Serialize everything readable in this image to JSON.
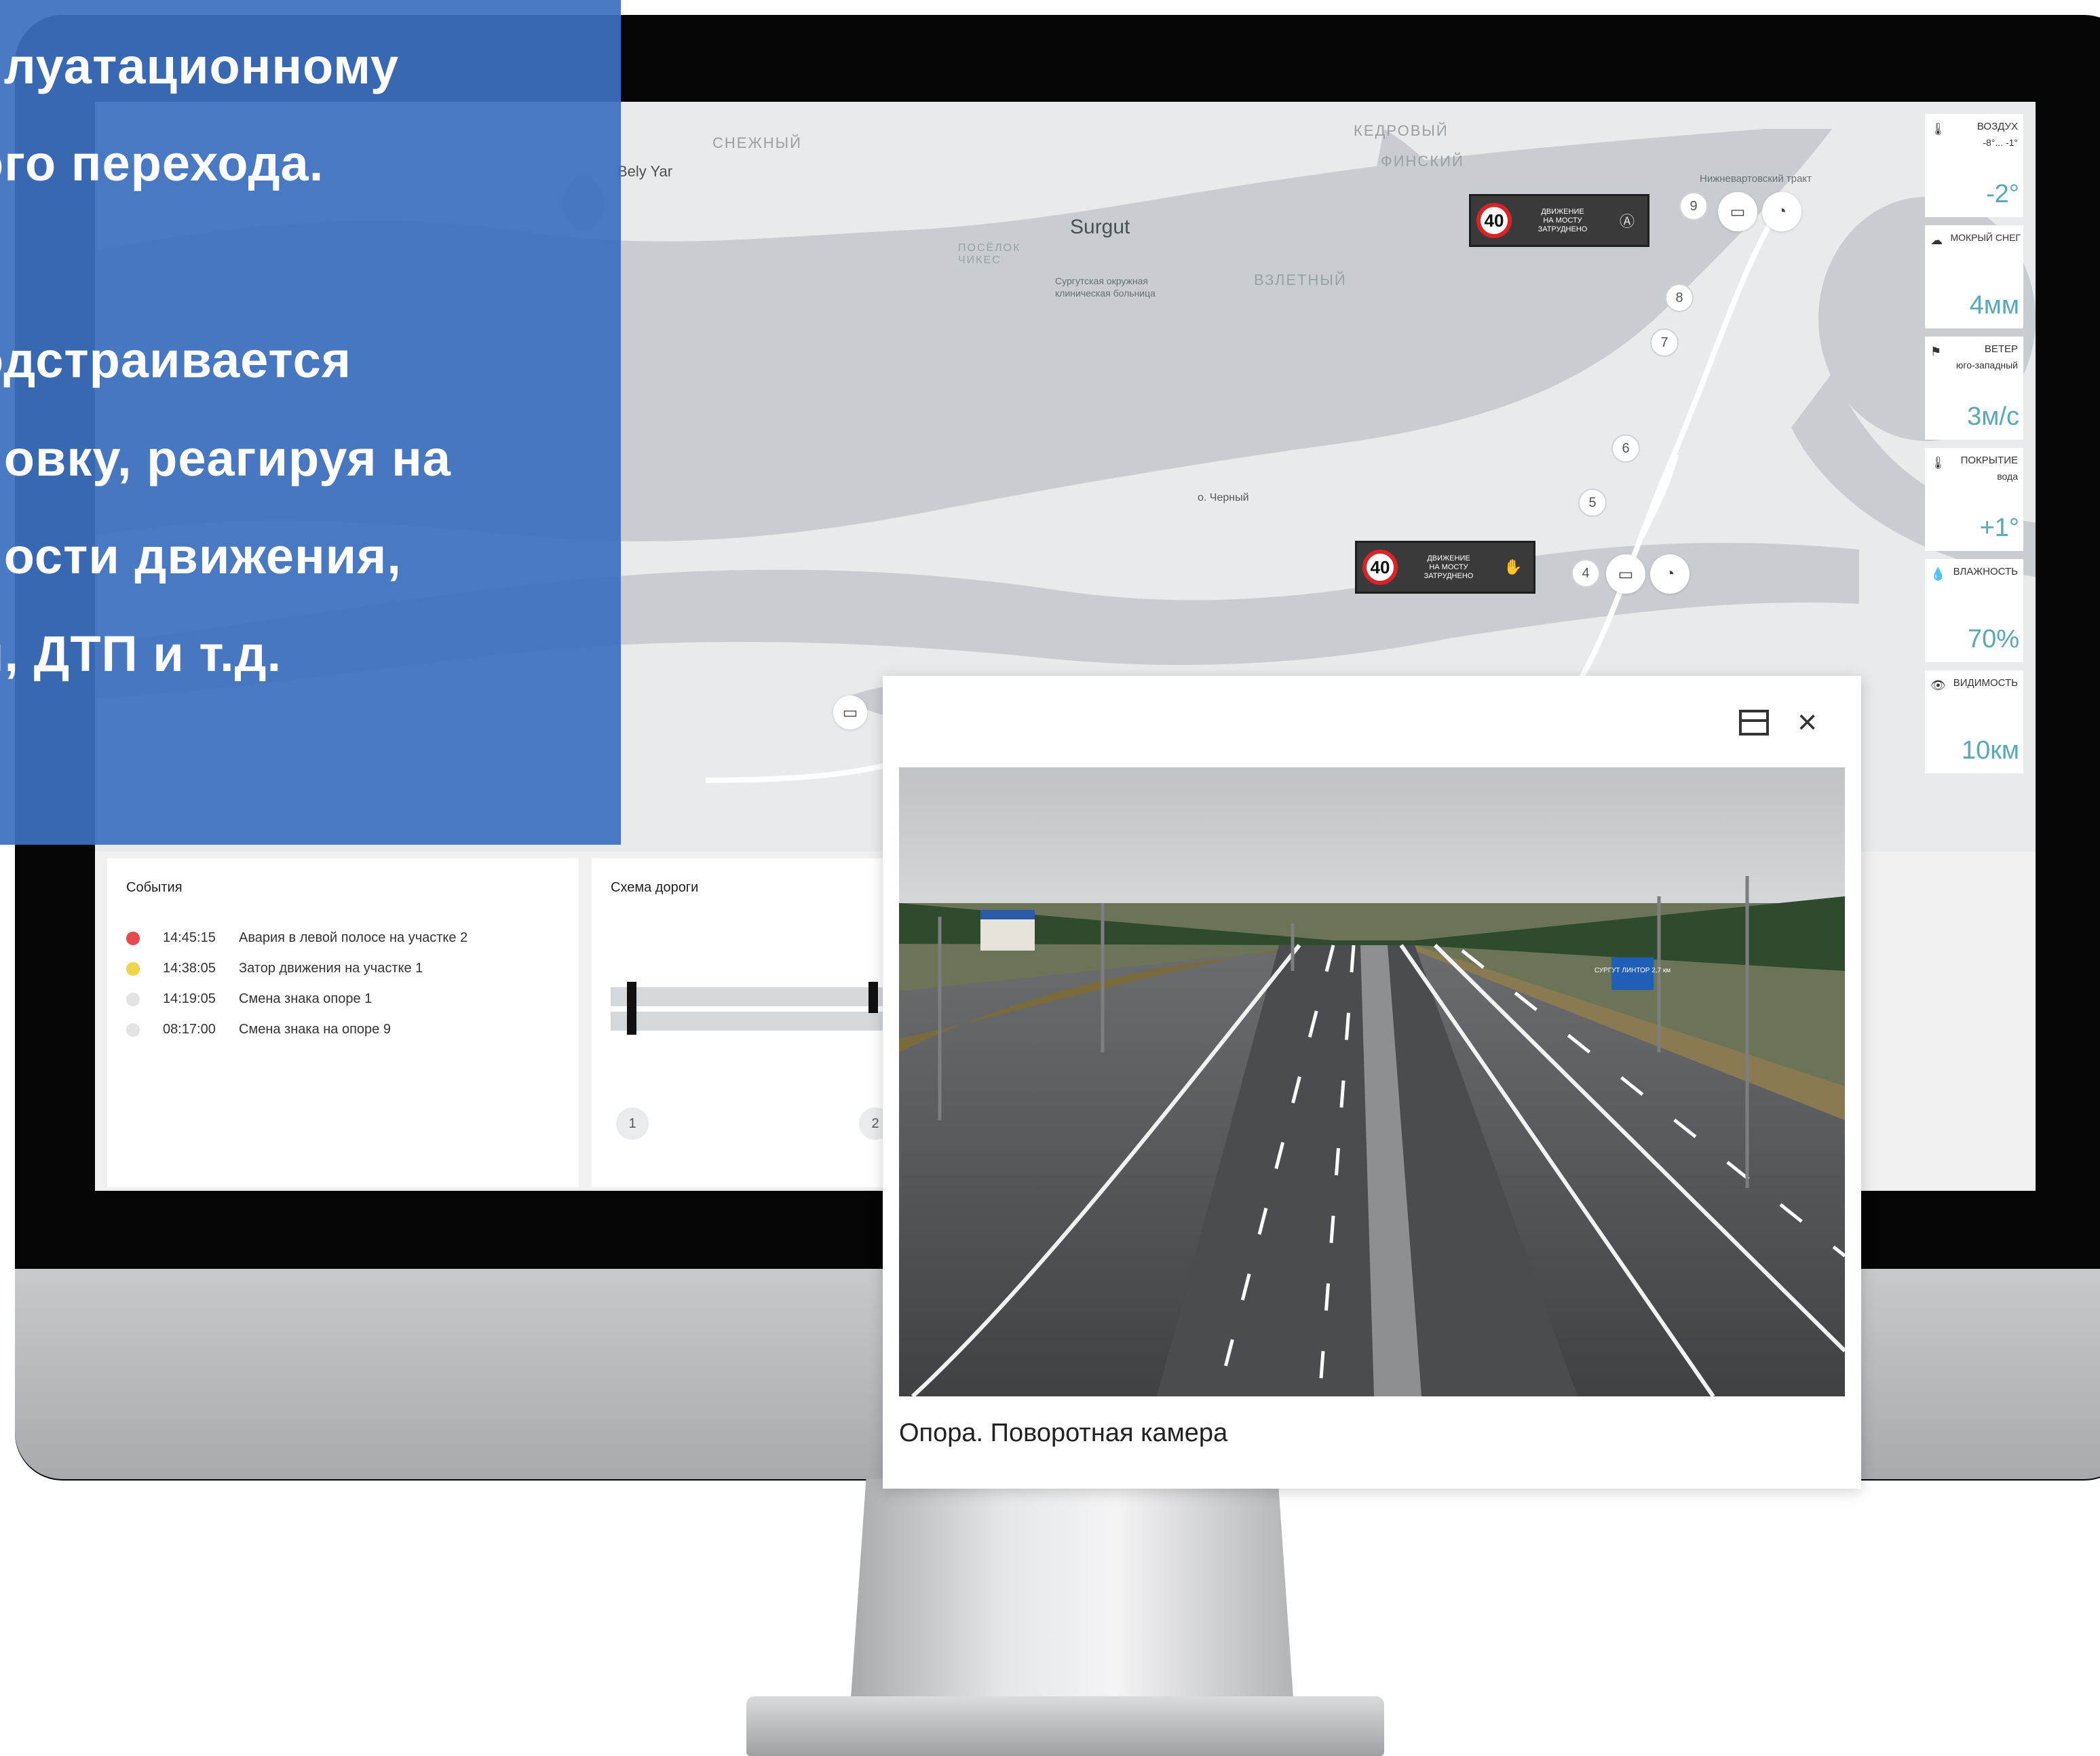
{
  "overlay": {
    "lines": [
      "плуатационному",
      "ого перехода.",
      "одстраивается",
      "новку, реагируя на",
      "ности движения,",
      "и, ДТП и т.д."
    ]
  },
  "map": {
    "labels": {
      "snezhny": "СНЕЖНЫЙ",
      "bely_yar": "Bely Yar",
      "kedrovy": "КЕДРОВЫЙ",
      "finsky": "ФИНСКИЙ",
      "surgut": "Surgut",
      "hospital": "Сургутская окружная клиническая больница",
      "poselok": "ПОСЁЛОК ЧИКЕС",
      "vzletny": "ВЗЛЕТНЫЙ",
      "tract": "Нижневартовский тракт",
      "o_cherny": "о. Черный"
    },
    "pins": [
      "9",
      "8",
      "7",
      "6",
      "5",
      "4"
    ],
    "signs": [
      {
        "speed": "40",
        "text": "ДВИЖЕНИЕ\nНА МОСТУ\nЗАТРУДНЕНО",
        "icon": "auto-mode-icon"
      },
      {
        "speed": "40",
        "text": "ДВИЖЕНИЕ\nНА МОСТУ\nЗАТРУДНЕНО",
        "icon": "hand-stop-icon"
      }
    ]
  },
  "weather": [
    {
      "title": "ВОЗДУХ",
      "sub": "-8°... -1°",
      "value": "-2°",
      "icon": "thermometer-icon"
    },
    {
      "title": "МОКРЫЙ СНЕГ",
      "sub": "",
      "value": "4мм",
      "icon": "snow-cloud-icon"
    },
    {
      "title": "ВЕТЕР",
      "sub": "юго-западный",
      "value": "3м/с",
      "icon": "windsock-icon"
    },
    {
      "title": "ПОКРЫТИЕ",
      "sub": "вода",
      "value": "+1°",
      "icon": "thermometer-icon"
    },
    {
      "title": "ВЛАЖНОСТЬ",
      "sub": "",
      "value": "70%",
      "icon": "drop-icon"
    },
    {
      "title": "ВИДИМОСТЬ",
      "sub": "",
      "value": "10км",
      "icon": "eye-icon"
    }
  ],
  "events": {
    "title": "События",
    "items": [
      {
        "time": "14:45:15",
        "text": "Авария в левой полосе на участке 2",
        "color": "#e5484d"
      },
      {
        "time": "14:38:05",
        "text": "Затор движения на участке 1",
        "color": "#f1d44a"
      },
      {
        "time": "14:19:05",
        "text": "Смена знака опоре 1",
        "color": "#e3e3e3"
      },
      {
        "time": "08:17:00",
        "text": "Смена знака на опоре 9",
        "color": "#e3e3e3"
      }
    ]
  },
  "road_scheme": {
    "title": "Схема дороги",
    "nodes": [
      "1",
      "2"
    ]
  },
  "popup": {
    "caption": "Опора. Поворотная камера",
    "road_sign": "СУРГУТ\nЛИНТОР\n2,7 км"
  },
  "colors": {
    "overlay": "#3c70be",
    "accent": "#58a8b8",
    "alert": "#d92326"
  }
}
